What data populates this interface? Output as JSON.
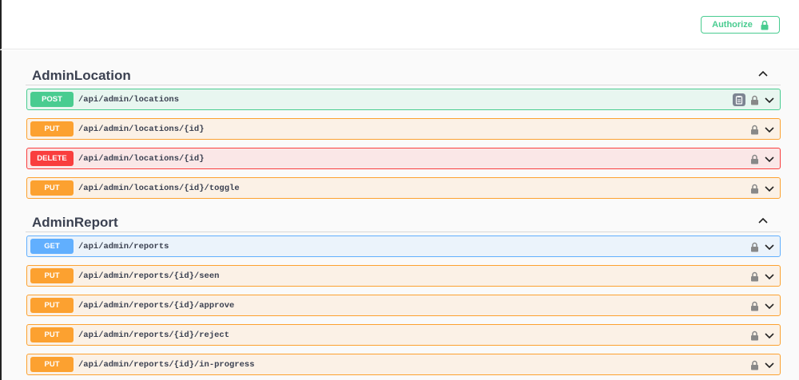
{
  "header": {
    "authorize_label": "Authorize",
    "authorize_icon": "lock-icon"
  },
  "sections": [
    {
      "title": "AdminLocation",
      "toggle_icon": "chevron-up-icon",
      "operations": [
        {
          "method": "POST",
          "path": "/api/admin/locations",
          "has_copy": true
        },
        {
          "method": "PUT",
          "path": "/api/admin/locations/{id}"
        },
        {
          "method": "DELETE",
          "path": "/api/admin/locations/{id}"
        },
        {
          "method": "PUT",
          "path": "/api/admin/locations/{id}/toggle"
        }
      ]
    },
    {
      "title": "AdminReport",
      "toggle_icon": "chevron-up-icon",
      "operations": [
        {
          "method": "GET",
          "path": "/api/admin/reports"
        },
        {
          "method": "PUT",
          "path": "/api/admin/reports/{id}/seen"
        },
        {
          "method": "PUT",
          "path": "/api/admin/reports/{id}/approve"
        },
        {
          "method": "PUT",
          "path": "/api/admin/reports/{id}/reject"
        },
        {
          "method": "PUT",
          "path": "/api/admin/reports/{id}/in-progress"
        }
      ]
    }
  ],
  "colors": {
    "post": "#49cc90",
    "put": "#fca130",
    "delete": "#f93e3e",
    "get": "#61affe",
    "text": "#3b4151"
  }
}
